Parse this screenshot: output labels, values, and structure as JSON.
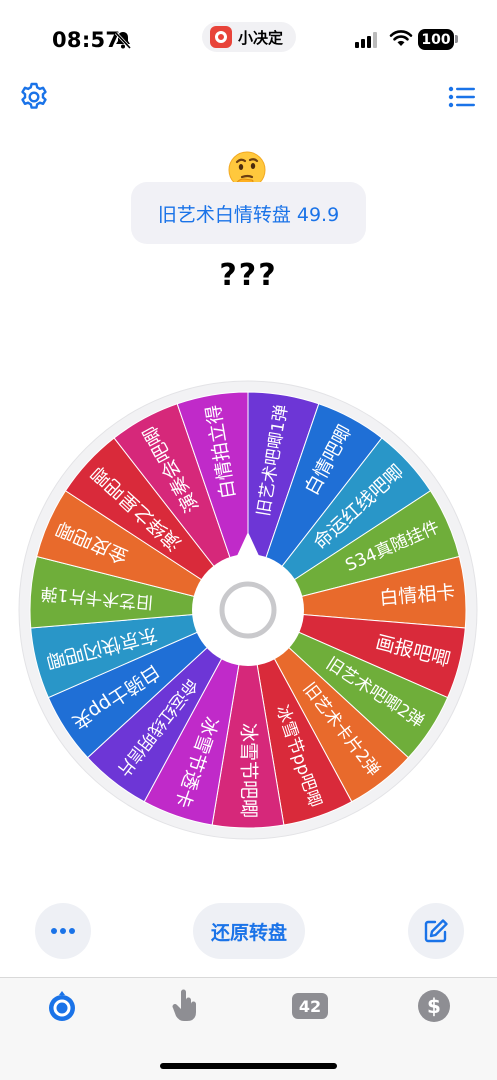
{
  "status_bar": {
    "time": "08:57",
    "app_name": "小决定",
    "battery": "100"
  },
  "header": {
    "emoji": "🤔",
    "wheel_title": "旧艺术白情转盘 49.9",
    "result": "???"
  },
  "wheel": {
    "segments": [
      {
        "label": "旧艺术吧唧1弹",
        "color": "#6d36d6"
      },
      {
        "label": "白情吧唧",
        "color": "#1f6fd6"
      },
      {
        "label": "命运红线吧唧",
        "color": "#2996c8"
      },
      {
        "label": "S34真随挂件",
        "color": "#6fae3a"
      },
      {
        "label": "白情相卡",
        "color": "#e86a2c"
      },
      {
        "label": "画报吧唧",
        "color": "#d92a3a"
      },
      {
        "label": "旧艺术吧唧2弹",
        "color": "#6fae3a"
      },
      {
        "label": "旧艺术卡片2弹",
        "color": "#e86a2c"
      },
      {
        "label": "冰雪节pp吧唧",
        "color": "#d92a3a"
      },
      {
        "label": "冰雪节吧唧",
        "color": "#d6287a"
      },
      {
        "label": "冰雪节透卡",
        "color": "#c02ac9"
      },
      {
        "label": "命运红线明信片",
        "color": "#6d36d6"
      },
      {
        "label": "白骑士pp夹",
        "color": "#1f6fd6"
      },
      {
        "label": "东京快闪吧唧",
        "color": "#2996c8"
      },
      {
        "label": "旧艺术卡片1弹",
        "color": "#6fae3a"
      },
      {
        "label": "金皮吧唧",
        "color": "#e86a2c"
      },
      {
        "label": "演绎之星吧唧",
        "color": "#d92a3a"
      },
      {
        "label": "演奏会吧唧",
        "color": "#d6287a"
      },
      {
        "label": "白情拍立得",
        "color": "#c02ac9"
      }
    ]
  },
  "actions": {
    "reset_label": "还原转盘"
  },
  "tabs": {
    "badge_count": "42",
    "dollar": "$"
  },
  "colors": {
    "accent": "#1a73e8",
    "tab_inactive": "#8e8e93"
  }
}
